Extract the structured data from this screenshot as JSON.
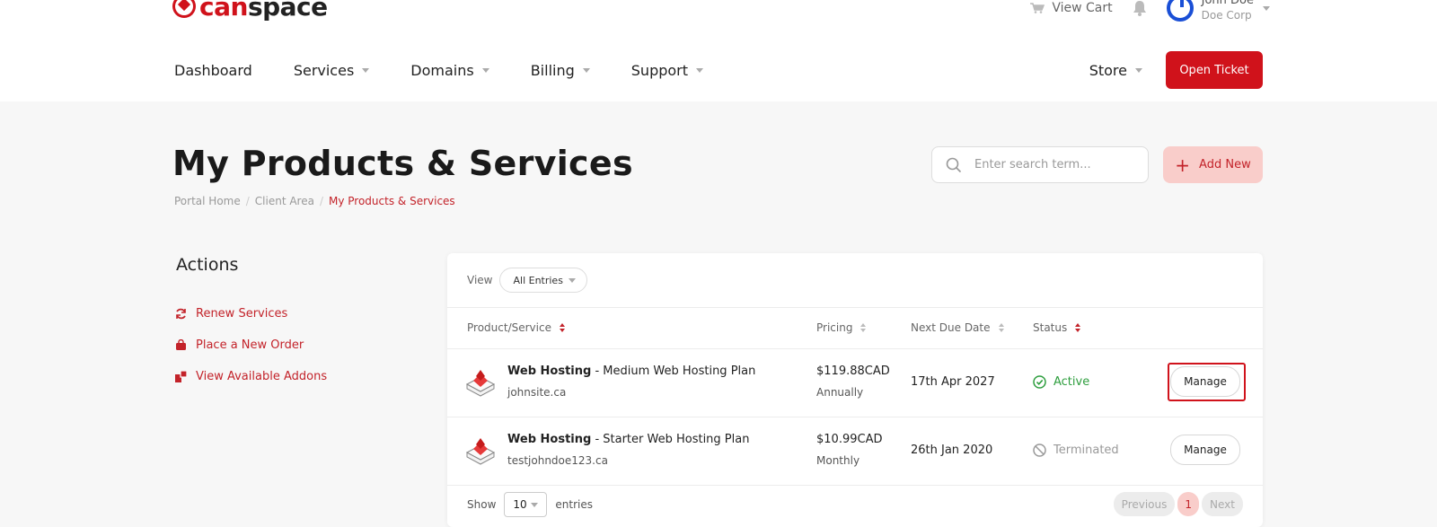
{
  "brand": {
    "name_part1": "can",
    "name_part2": "space",
    "accent_color": "#d0121b"
  },
  "topbar": {
    "view_cart": "View Cart",
    "user_name": "John Doe",
    "user_company": "Doe Corp"
  },
  "nav": {
    "items": [
      "Dashboard",
      "Services",
      "Domains",
      "Billing",
      "Support"
    ],
    "store": "Store",
    "open_ticket": "Open Ticket"
  },
  "page": {
    "title": "My Products & Services",
    "breadcrumb": [
      "Portal Home",
      "Client Area",
      "My Products & Services"
    ],
    "search_placeholder": "Enter search term...",
    "add_new": "Add New"
  },
  "sidebar": {
    "title": "Actions",
    "items": [
      {
        "label": "Renew Services",
        "icon": "refresh-icon"
      },
      {
        "label": "Place a New Order",
        "icon": "shopping-bag-icon"
      },
      {
        "label": "View Available Addons",
        "icon": "addons-icon"
      }
    ]
  },
  "table": {
    "view_label": "View",
    "view_value": "All Entries",
    "columns": [
      "Product/Service",
      "Pricing",
      "Next Due Date",
      "Status"
    ],
    "rows": [
      {
        "product": "Web Hosting",
        "plan": " - Medium Web Hosting Plan",
        "domain": "johnsite.ca",
        "price": "$119.88CAD",
        "cycle": "Annually",
        "due": "17th Apr 2027",
        "status": "Active",
        "action": "Manage"
      },
      {
        "product": "Web Hosting",
        "plan": " - Starter Web Hosting Plan",
        "domain": "testjohndoe123.ca",
        "price": "$10.99CAD",
        "cycle": "Monthly",
        "due": "26th Jan 2020",
        "status": "Terminated",
        "action": "Manage"
      }
    ],
    "show_label": "Show",
    "show_value": "10",
    "entries_label": "entries",
    "pagination": {
      "previous": "Previous",
      "current": "1",
      "next": "Next"
    }
  }
}
